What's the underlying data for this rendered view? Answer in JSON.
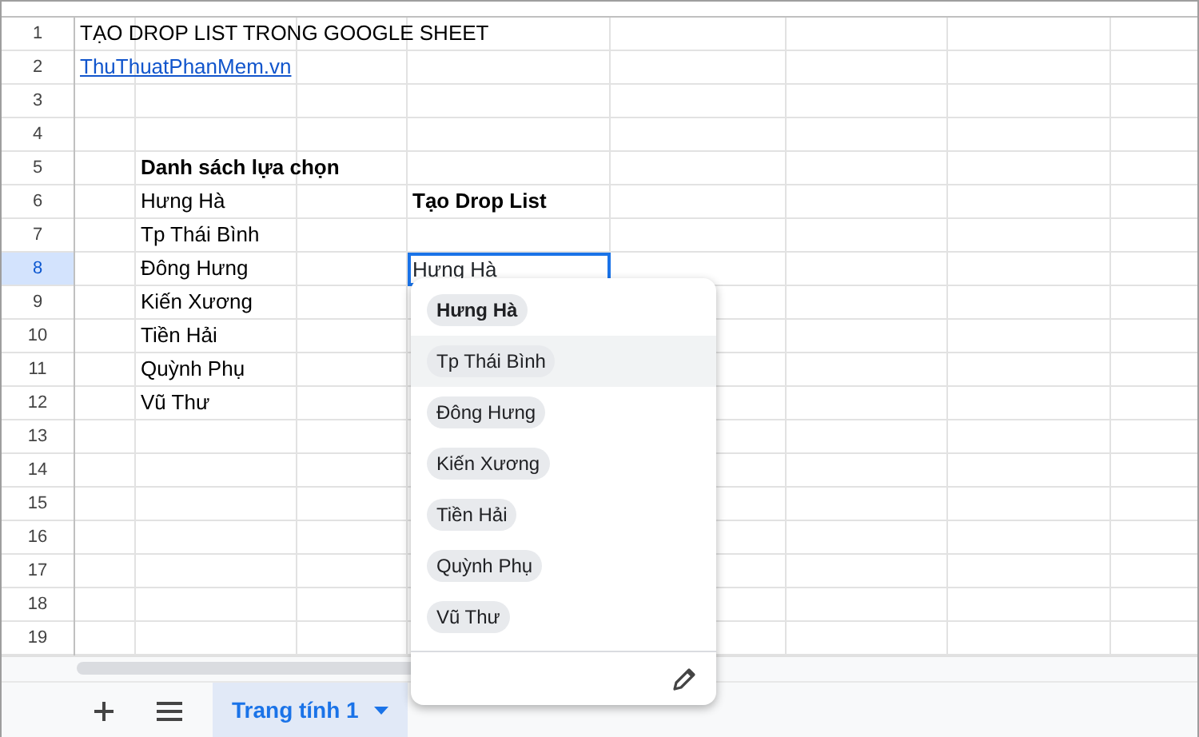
{
  "sheet": {
    "row_numbers": [
      {
        "label": "1",
        "selected": false
      },
      {
        "label": "2",
        "selected": false
      },
      {
        "label": "3",
        "selected": false
      },
      {
        "label": "4",
        "selected": false
      },
      {
        "label": "5",
        "selected": false
      },
      {
        "label": "6",
        "selected": false
      },
      {
        "label": "7",
        "selected": false
      },
      {
        "label": "8",
        "selected": true
      },
      {
        "label": "9",
        "selected": false
      },
      {
        "label": "10",
        "selected": false
      },
      {
        "label": "11",
        "selected": false
      },
      {
        "label": "12",
        "selected": false
      },
      {
        "label": "13",
        "selected": false
      },
      {
        "label": "14",
        "selected": false
      },
      {
        "label": "15",
        "selected": false
      },
      {
        "label": "16",
        "selected": false
      },
      {
        "label": "17",
        "selected": false
      },
      {
        "label": "18",
        "selected": false
      },
      {
        "label": "19",
        "selected": false
      }
    ],
    "title_cell": "TẠO DROP LIST TRONG GOOGLE SHEET",
    "link_cell": "ThuThuatPhanMem.vn",
    "choice_list": {
      "heading": "Danh sách lựa chọn",
      "items": [
        "Hưng Hà",
        "Tp Thái Bình",
        "Đông Hưng",
        "Kiến Xương",
        "Tiền Hải",
        "Quỳnh Phụ",
        "Vũ Thư"
      ]
    },
    "drop_list": {
      "heading": "Tạo Drop List",
      "value": "Hưng Hà"
    }
  },
  "dropdown": {
    "options": [
      {
        "label": "Hưng Hà",
        "current": true,
        "highlighted": false
      },
      {
        "label": "Tp Thái Bình",
        "current": false,
        "highlighted": true
      },
      {
        "label": "Đông Hưng",
        "current": false,
        "highlighted": false
      },
      {
        "label": "Kiến Xương",
        "current": false,
        "highlighted": false
      },
      {
        "label": "Tiền Hải",
        "current": false,
        "highlighted": false
      },
      {
        "label": "Quỳnh Phụ",
        "current": false,
        "highlighted": false
      },
      {
        "label": "Vũ Thư",
        "current": false,
        "highlighted": false
      }
    ]
  },
  "sheet_tabs": [
    {
      "label": "Trang tính 1",
      "selected": true
    }
  ]
}
